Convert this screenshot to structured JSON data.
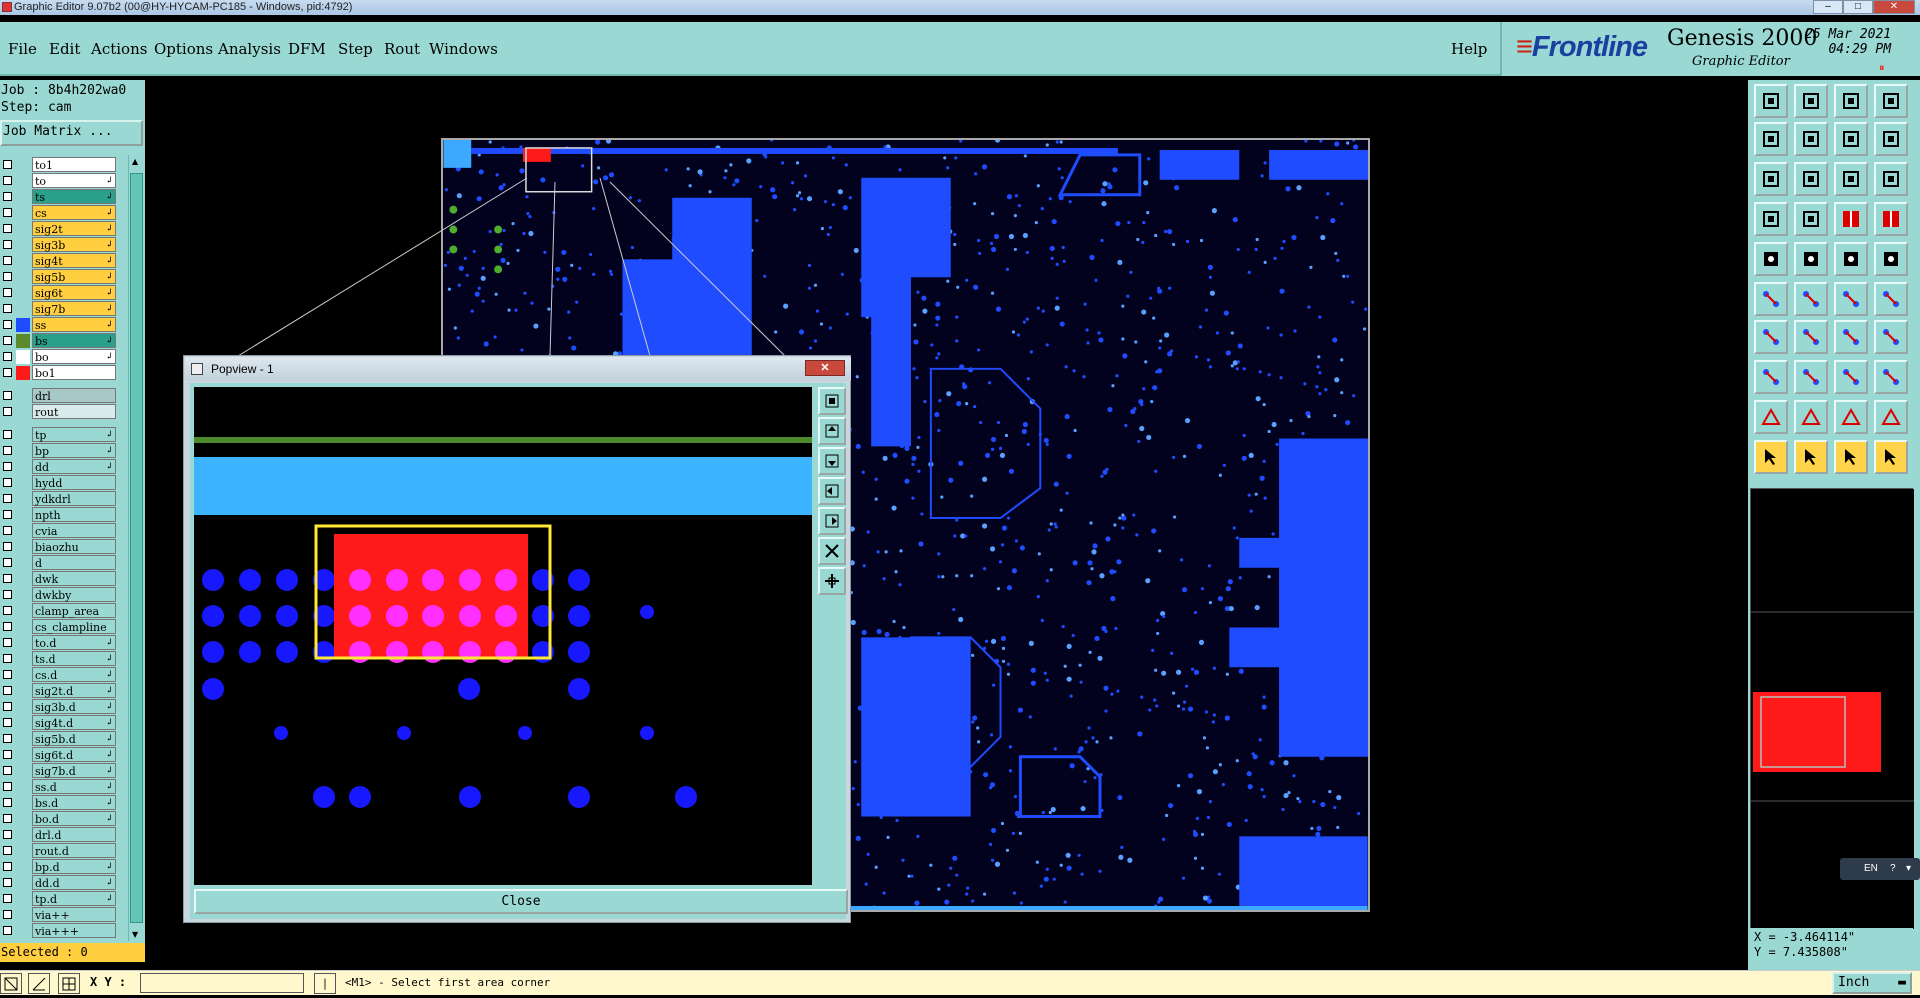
{
  "window": {
    "title": "Graphic Editor 9.07b2 (00@HY-HYCAM-PC185 - Windows, pid:4792)",
    "minimize": "–",
    "maximize": "□",
    "close": "✕"
  },
  "menu": {
    "items": [
      "File",
      "Edit",
      "Actions",
      "Options",
      "Analysis",
      "DFM",
      "Step",
      "Rout",
      "Windows"
    ],
    "help": "Help"
  },
  "brand": {
    "logo_prefix": "≡",
    "logo": "Frontline",
    "product": "Genesis 2000",
    "subtitle": "Graphic Editor",
    "date": "25 Mar 2021",
    "time": "04:29 PM",
    "pause_icon": "⏸"
  },
  "job": {
    "job_line": "Job : 8b4h202wa0",
    "step_line": "Step: cam",
    "matrix_button": "Job Matrix ..."
  },
  "layers": [
    {
      "name": "to1",
      "bg": "#ffffff",
      "sw": "",
      "arrow": ""
    },
    {
      "name": "to",
      "bg": "#ffffff",
      "sw": "",
      "arrow": "↲"
    },
    {
      "name": "ts",
      "bg": "#2aa08a",
      "sw": "",
      "arrow": "↲"
    },
    {
      "name": "cs",
      "bg": "#ffcf40",
      "sw": "",
      "arrow": "↲"
    },
    {
      "name": "sig2t",
      "bg": "#ffcf40",
      "sw": "",
      "arrow": "↲"
    },
    {
      "name": "sig3b",
      "bg": "#ffcf40",
      "sw": "",
      "arrow": "↲"
    },
    {
      "name": "sig4t",
      "bg": "#ffcf40",
      "sw": "",
      "arrow": "↲"
    },
    {
      "name": "sig5b",
      "bg": "#ffcf40",
      "sw": "",
      "arrow": "↲"
    },
    {
      "name": "sig6t",
      "bg": "#ffcf40",
      "sw": "",
      "arrow": "↲"
    },
    {
      "name": "sig7b",
      "bg": "#ffcf40",
      "sw": "",
      "arrow": "↲"
    },
    {
      "name": "ss",
      "bg": "#ffcf40",
      "sw": "#1f4cff",
      "arrow": "↲"
    },
    {
      "name": "bs",
      "bg": "#2aa08a",
      "sw": "#5a8a2a",
      "arrow": "↲"
    },
    {
      "name": "bo",
      "bg": "#ffffff",
      "sw": "#ffffff",
      "arrow": "↲"
    },
    {
      "name": "bo1",
      "bg": "#ffffff",
      "sw": "#ff1a1a",
      "arrow": ""
    },
    {
      "name": "drl",
      "bg": "#a8c8c8",
      "sw": "",
      "arrow": ""
    },
    {
      "name": "rout",
      "bg": "#d9eaea",
      "sw": "",
      "arrow": ""
    },
    {
      "name": "tp",
      "bg": "#9ad9d3",
      "sw": "",
      "arrow": "↲"
    },
    {
      "name": "bp",
      "bg": "#9ad9d3",
      "sw": "",
      "arrow": "↲"
    },
    {
      "name": "dd",
      "bg": "#9ad9d3",
      "sw": "",
      "arrow": "↲"
    },
    {
      "name": "hydd",
      "bg": "#9ad9d3",
      "sw": "",
      "arrow": ""
    },
    {
      "name": "ydkdrl",
      "bg": "#9ad9d3",
      "sw": "",
      "arrow": ""
    },
    {
      "name": "npth",
      "bg": "#9ad9d3",
      "sw": "",
      "arrow": ""
    },
    {
      "name": "cvia",
      "bg": "#9ad9d3",
      "sw": "",
      "arrow": ""
    },
    {
      "name": "biaozhu",
      "bg": "#9ad9d3",
      "sw": "",
      "arrow": ""
    },
    {
      "name": "d",
      "bg": "#9ad9d3",
      "sw": "",
      "arrow": ""
    },
    {
      "name": "dwk",
      "bg": "#9ad9d3",
      "sw": "",
      "arrow": ""
    },
    {
      "name": "dwkby",
      "bg": "#9ad9d3",
      "sw": "",
      "arrow": ""
    },
    {
      "name": "clamp_area",
      "bg": "#9ad9d3",
      "sw": "",
      "arrow": ""
    },
    {
      "name": "cs_clampline",
      "bg": "#9ad9d3",
      "sw": "",
      "arrow": ""
    },
    {
      "name": "to.d",
      "bg": "#9ad9d3",
      "sw": "",
      "arrow": "↲"
    },
    {
      "name": "ts.d",
      "bg": "#9ad9d3",
      "sw": "",
      "arrow": "↲"
    },
    {
      "name": "cs.d",
      "bg": "#9ad9d3",
      "sw": "",
      "arrow": "↲"
    },
    {
      "name": "sig2t.d",
      "bg": "#9ad9d3",
      "sw": "",
      "arrow": "↲"
    },
    {
      "name": "sig3b.d",
      "bg": "#9ad9d3",
      "sw": "",
      "arrow": "↲"
    },
    {
      "name": "sig4t.d",
      "bg": "#9ad9d3",
      "sw": "",
      "arrow": "↲"
    },
    {
      "name": "sig5b.d",
      "bg": "#9ad9d3",
      "sw": "",
      "arrow": "↲"
    },
    {
      "name": "sig6t.d",
      "bg": "#9ad9d3",
      "sw": "",
      "arrow": "↲"
    },
    {
      "name": "sig7b.d",
      "bg": "#9ad9d3",
      "sw": "",
      "arrow": "↲"
    },
    {
      "name": "ss.d",
      "bg": "#9ad9d3",
      "sw": "",
      "arrow": "↲"
    },
    {
      "name": "bs.d",
      "bg": "#9ad9d3",
      "sw": "",
      "arrow": "↲"
    },
    {
      "name": "bo.d",
      "bg": "#9ad9d3",
      "sw": "",
      "arrow": "↲"
    },
    {
      "name": "drl.d",
      "bg": "#9ad9d3",
      "sw": "",
      "arrow": ""
    },
    {
      "name": "rout.d",
      "bg": "#9ad9d3",
      "sw": "",
      "arrow": ""
    },
    {
      "name": "bp.d",
      "bg": "#9ad9d3",
      "sw": "",
      "arrow": "↲"
    },
    {
      "name": "dd.d",
      "bg": "#9ad9d3",
      "sw": "",
      "arrow": "↲"
    },
    {
      "name": "tp.d",
      "bg": "#9ad9d3",
      "sw": "",
      "arrow": "↲"
    },
    {
      "name": "via++",
      "bg": "#9ad9d3",
      "sw": "",
      "arrow": ""
    },
    {
      "name": "via+++",
      "bg": "#9ad9d3",
      "sw": "",
      "arrow": ""
    }
  ],
  "status": {
    "selected": "Selected : 0",
    "xy_label": "X Y :",
    "xy_value": "",
    "prompt": "<M1> - Select first area corner",
    "units": "Inch",
    "x_coord": "X = -3.464114\"",
    "y_coord": "Y = 7.435808\""
  },
  "popview": {
    "title": "Popview - 1",
    "close_button": "Close"
  },
  "tray": {
    "lang": "EN"
  },
  "colors": {
    "panel": "#9ad9d3",
    "copper": "#1f4cff",
    "highlight": "#ff1a1a",
    "accent": "#ffcf40"
  }
}
